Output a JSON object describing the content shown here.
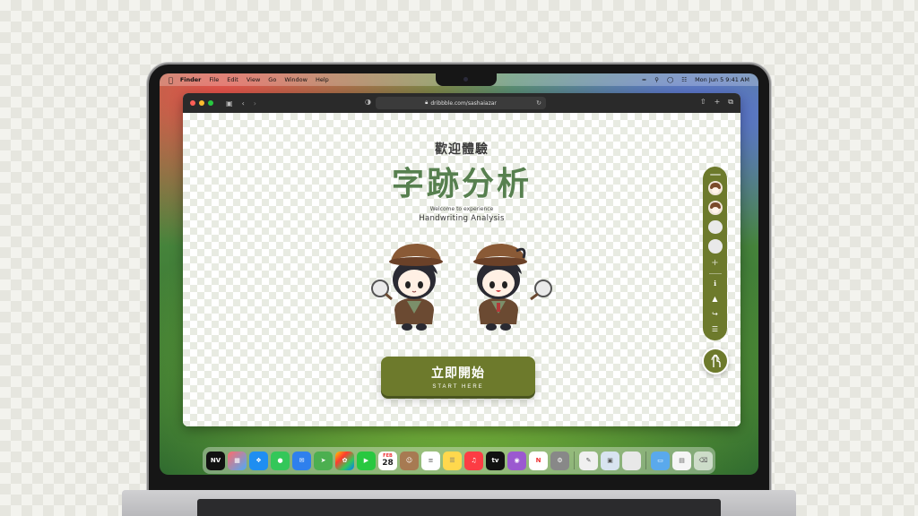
{
  "menubar": {
    "items": [
      "Finder",
      "File",
      "Edit",
      "View",
      "Go",
      "Window",
      "Help"
    ],
    "clock": "Mon Jun 5  9:41 AM"
  },
  "browser": {
    "url": "dribbble.com/sashaiazar"
  },
  "page": {
    "welcome_cn": "歡迎體驗",
    "title_cn": "字跡分析",
    "welcome_en": "Welcome to experience",
    "title_en": "Handwriting Analysis",
    "start_cn": "立即開始",
    "start_en": "START HERE"
  },
  "dock": {
    "calendar_month": "FEB",
    "calendar_day": "28",
    "tv_label": "tv"
  },
  "colors": {
    "accent": "#6d7a2c",
    "title_green": "#57804f"
  }
}
